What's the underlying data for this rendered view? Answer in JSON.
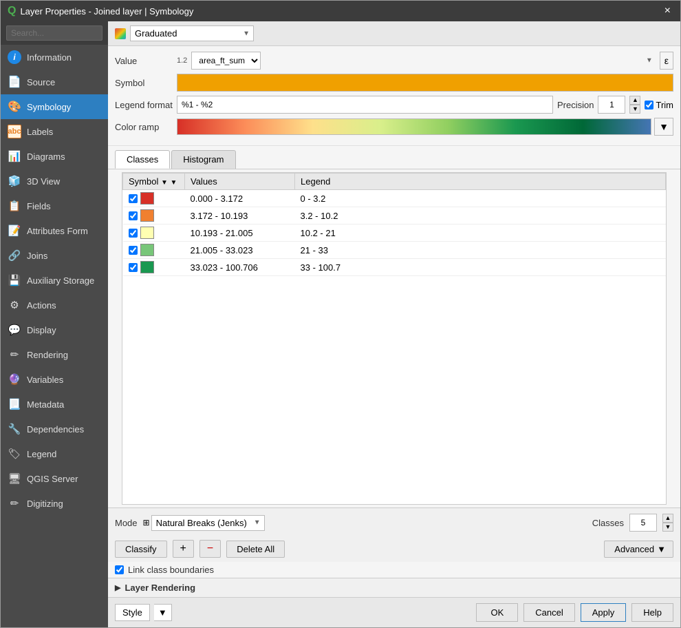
{
  "window": {
    "title": "Layer Properties - Joined layer | Symbology",
    "close_icon": "×"
  },
  "sidebar": {
    "search_placeholder": "Search...",
    "items": [
      {
        "id": "information",
        "label": "Information",
        "icon": "ℹ"
      },
      {
        "id": "source",
        "label": "Source",
        "icon": "📄"
      },
      {
        "id": "symbology",
        "label": "Symbology",
        "icon": "🎨",
        "active": true
      },
      {
        "id": "labels",
        "label": "Labels",
        "icon": "abc"
      },
      {
        "id": "diagrams",
        "label": "Diagrams",
        "icon": "📊"
      },
      {
        "id": "3dview",
        "label": "3D View",
        "icon": "🧊"
      },
      {
        "id": "fields",
        "label": "Fields",
        "icon": "📋"
      },
      {
        "id": "attributes-form",
        "label": "Attributes Form",
        "icon": "📝"
      },
      {
        "id": "joins",
        "label": "Joins",
        "icon": "🔗"
      },
      {
        "id": "auxiliary-storage",
        "label": "Auxiliary Storage",
        "icon": "💾"
      },
      {
        "id": "actions",
        "label": "Actions",
        "icon": "⚙"
      },
      {
        "id": "display",
        "label": "Display",
        "icon": "💬"
      },
      {
        "id": "rendering",
        "label": "Rendering",
        "icon": "✏"
      },
      {
        "id": "variables",
        "label": "Variables",
        "icon": "🔮"
      },
      {
        "id": "metadata",
        "label": "Metadata",
        "icon": "📃"
      },
      {
        "id": "dependencies",
        "label": "Dependencies",
        "icon": "🔧"
      },
      {
        "id": "legend",
        "label": "Legend",
        "icon": "🏷"
      },
      {
        "id": "qgis-server",
        "label": "QGIS Server",
        "icon": "🖥"
      },
      {
        "id": "digitizing",
        "label": "Digitizing",
        "icon": "✏"
      }
    ]
  },
  "renderer": {
    "type": "Graduated",
    "type_icon": "gradient"
  },
  "form": {
    "value_label": "Value",
    "value_field": "area_ft_sum",
    "value_prefix": "1.2",
    "symbol_label": "Symbol",
    "legend_label": "Legend format",
    "legend_value": "%1 - %2",
    "precision_label": "Precision",
    "precision_value": "1",
    "trim_label": "Trim",
    "trim_checked": true,
    "colorramp_label": "Color ramp"
  },
  "tabs": [
    {
      "id": "classes",
      "label": "Classes",
      "active": true
    },
    {
      "id": "histogram",
      "label": "Histogram",
      "active": false
    }
  ],
  "table": {
    "headers": [
      "Symbol",
      "Values",
      "Legend"
    ],
    "rows": [
      {
        "checked": true,
        "color": "#d73027",
        "values": "0.000 - 3.172",
        "legend": "0 - 3.2"
      },
      {
        "checked": true,
        "color": "#f08030",
        "values": "3.172 - 10.193",
        "legend": "3.2 - 10.2"
      },
      {
        "checked": true,
        "color": "#ffffb2",
        "values": "10.193 - 21.005",
        "legend": "10.2 - 21"
      },
      {
        "checked": true,
        "color": "#78c679",
        "values": "21.005 - 33.023",
        "legend": "21 - 33"
      },
      {
        "checked": true,
        "color": "#1a9850",
        "values": "33.023 - 100.706",
        "legend": "33 - 100.7"
      }
    ]
  },
  "bottom": {
    "mode_label": "Mode",
    "mode_value": "Natural Breaks (Jenks)",
    "classes_label": "Classes",
    "classes_value": "5",
    "classify_label": "Classify",
    "add_label": "+",
    "remove_label": "−",
    "delete_all_label": "Delete All",
    "advanced_label": "Advanced",
    "link_boundary_label": "Link class boundaries"
  },
  "layer_rendering": {
    "label": "Layer Rendering"
  },
  "footer": {
    "style_label": "Style",
    "ok_label": "OK",
    "cancel_label": "Cancel",
    "apply_label": "Apply",
    "help_label": "Help"
  }
}
